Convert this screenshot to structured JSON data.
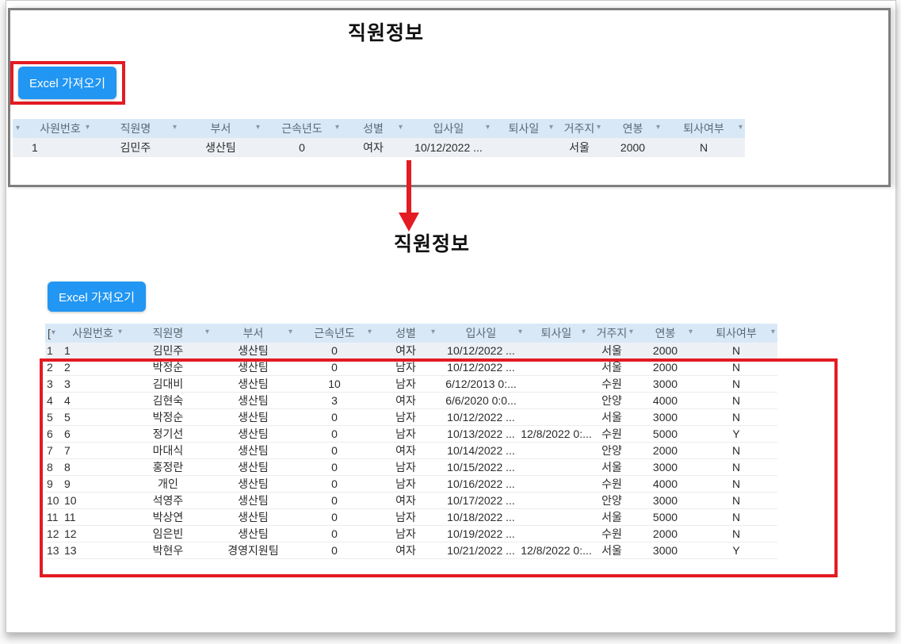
{
  "panels": {
    "top": {
      "title": "직원정보",
      "button_label": "Excel 가져오기",
      "table": {
        "selector_header": "",
        "headers": [
          "사원번호",
          "직원명",
          "부서",
          "근속년도",
          "성별",
          "입사일",
          "퇴사일",
          "거주지",
          "연봉",
          "퇴사여부"
        ],
        "rows": [
          {
            "rownum": "",
            "cells": [
              "1",
              "김민주",
              "생산팀",
              "0",
              "여자",
              "10/12/2022 ...",
              "",
              "서울",
              "2000",
              "N"
            ]
          }
        ]
      }
    },
    "bottom": {
      "title": "직원정보",
      "button_label": "Excel 가져오기",
      "table": {
        "selector_header": "[",
        "headers": [
          "사원번호",
          "직원명",
          "부서",
          "근속년도",
          "성별",
          "입사일",
          "퇴사일",
          "거주지",
          "연봉",
          "퇴사여부"
        ],
        "rows": [
          {
            "rownum": "1",
            "cells": [
              "1",
              "김민주",
              "생산팀",
              "0",
              "여자",
              "10/12/2022 ...",
              "",
              "서울",
              "2000",
              "N"
            ]
          },
          {
            "rownum": "2",
            "cells": [
              "2",
              "박정순",
              "생산팀",
              "0",
              "남자",
              "10/12/2022 ...",
              "",
              "서울",
              "2000",
              "N"
            ]
          },
          {
            "rownum": "3",
            "cells": [
              "3",
              "김대비",
              "생산팀",
              "10",
              "남자",
              "6/12/2013 0:...",
              "",
              "수원",
              "3000",
              "N"
            ]
          },
          {
            "rownum": "4",
            "cells": [
              "4",
              "김현숙",
              "생산팀",
              "3",
              "여자",
              "6/6/2020 0:0...",
              "",
              "안양",
              "4000",
              "N"
            ]
          },
          {
            "rownum": "5",
            "cells": [
              "5",
              "박정순",
              "생산팀",
              "0",
              "남자",
              "10/12/2022 ...",
              "",
              "서울",
              "3000",
              "N"
            ]
          },
          {
            "rownum": "6",
            "cells": [
              "6",
              "정기선",
              "생산팀",
              "0",
              "남자",
              "10/13/2022 ...",
              "12/8/2022 0:...",
              "수원",
              "5000",
              "Y"
            ]
          },
          {
            "rownum": "7",
            "cells": [
              "7",
              "마대식",
              "생산팀",
              "0",
              "여자",
              "10/14/2022 ...",
              "",
              "안양",
              "2000",
              "N"
            ]
          },
          {
            "rownum": "8",
            "cells": [
              "8",
              "홍정란",
              "생산팀",
              "0",
              "남자",
              "10/15/2022 ...",
              "",
              "서울",
              "3000",
              "N"
            ]
          },
          {
            "rownum": "9",
            "cells": [
              "9",
              "개인",
              "생산팀",
              "0",
              "남자",
              "10/16/2022 ...",
              "",
              "수원",
              "4000",
              "N"
            ]
          },
          {
            "rownum": "10",
            "cells": [
              "10",
              "석영주",
              "생산팀",
              "0",
              "여자",
              "10/17/2022 ...",
              "",
              "안양",
              "3000",
              "N"
            ]
          },
          {
            "rownum": "11",
            "cells": [
              "11",
              "박상연",
              "생산팀",
              "0",
              "남자",
              "10/18/2022 ...",
              "",
              "서울",
              "5000",
              "N"
            ]
          },
          {
            "rownum": "12",
            "cells": [
              "12",
              "임은빈",
              "생산팀",
              "0",
              "남자",
              "10/19/2022 ...",
              "",
              "수원",
              "2000",
              "N"
            ]
          },
          {
            "rownum": "13",
            "cells": [
              "13",
              "박현우",
              "경영지원팀",
              "0",
              "여자",
              "10/21/2022 ...",
              "12/8/2022 0:...",
              "서울",
              "3000",
              "Y"
            ]
          }
        ]
      }
    }
  },
  "icons": {
    "filter_dropdown": "▾"
  },
  "colors": {
    "accent_blue": "#2196f3",
    "highlight_red": "#e31b23",
    "table_header_bg": "#d8e8f7",
    "selected_row_bg": "#edf1f6",
    "panel_border_gray": "#7f7f7f"
  }
}
